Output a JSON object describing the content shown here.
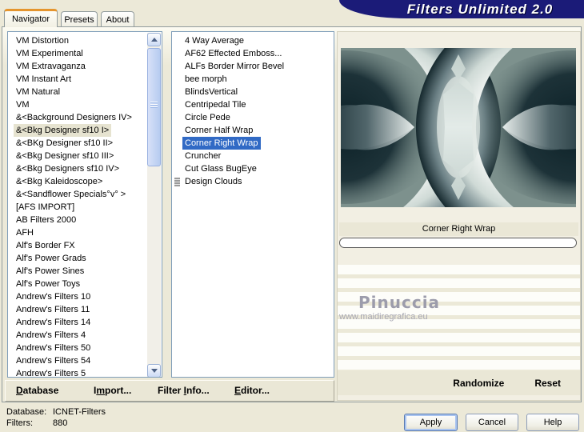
{
  "window": {
    "title": "Filters Unlimited 2.0"
  },
  "tabs": [
    {
      "label": "Navigator",
      "active": true
    },
    {
      "label": "Presets",
      "active": false
    },
    {
      "label": "About",
      "active": false
    }
  ],
  "category_list": {
    "items": [
      "VM Distortion",
      "VM Experimental",
      "VM Extravaganza",
      "VM Instant Art",
      "VM Natural",
      "VM",
      "&<Background Designers IV>",
      "&<Bkg Designer sf10 I>",
      "&<BKg Designer sf10 II>",
      "&<Bkg Designer sf10 III>",
      "&<Bkg Designers sf10 IV>",
      "&<Bkg Kaleidoscope>",
      "&<Sandflower Specials°v° >",
      "[AFS IMPORT]",
      "AB Filters 2000",
      "AFH",
      "Alf's Border FX",
      "Alf's Power Grads",
      "Alf's Power Sines",
      "Alf's Power Toys",
      "Andrew's Filters 10",
      "Andrew's Filters 11",
      "Andrew's Filters 14",
      "Andrew's Filters 4",
      "Andrew's Filters 50",
      "Andrew's Filters 54",
      "Andrew's Filters 5"
    ],
    "selected_index": 7
  },
  "filter_list": {
    "items": [
      "4 Way Average",
      "AF62 Effected Emboss...",
      "ALFs Border Mirror Bevel",
      "bee morph",
      "BlindsVertical",
      "Centripedal Tile",
      "Circle Pede",
      "Corner Half Wrap",
      "Corner Right Wrap",
      "Cruncher",
      "Cut Glass  BugEye",
      "Design Clouds"
    ],
    "selected_index": 8,
    "icon_index": 11
  },
  "preview": {
    "filter_name": "Corner Right Wrap"
  },
  "watermark": {
    "name": "Pinuccia",
    "url": "www.maidiregrafica.eu"
  },
  "toolbar": {
    "database": {
      "pre": "",
      "key": "D",
      "post": "atabase"
    },
    "import_btn": {
      "pre": "I",
      "key": "m",
      "post": "port..."
    },
    "filter_info": {
      "pre": "Filter ",
      "key": "I",
      "post": "nfo..."
    },
    "editor": {
      "pre": "",
      "key": "E",
      "post": "ditor..."
    },
    "randomize": "Randomize",
    "reset": "Reset"
  },
  "status": {
    "database_label": "Database:",
    "database_value": "ICNET-Filters",
    "filters_label": "Filters:",
    "filters_value": "880"
  },
  "buttons": {
    "apply": "Apply",
    "cancel": "Cancel",
    "help": "Help"
  },
  "colors": {
    "title_bar": "#1b1b78",
    "selection_blue": "#316ac5",
    "selection_inactive": "#e6e3d0",
    "dialog_bg": "#ece9d8",
    "active_tab_accent": "#e5952e",
    "preview_bg": "#7d918d"
  }
}
